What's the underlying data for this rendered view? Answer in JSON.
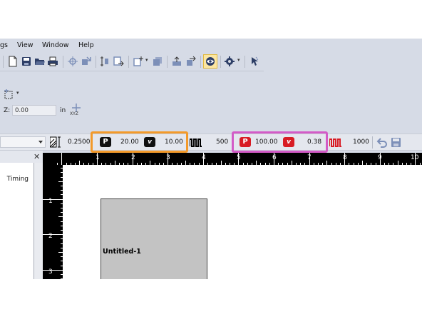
{
  "menu": [
    "gs",
    "View",
    "Window",
    "Help"
  ],
  "toolbar": {
    "icons": [
      "new-file-icon",
      "save-icon",
      "open-folder-icon",
      "print-icon",
      "crosshair-icon",
      "move-icon",
      "align-icon",
      "export-icon",
      "add-icon",
      "copy-icon",
      "upload-icon",
      "transfer-icon",
      "preview-icon",
      "settings-icon",
      "pointer-icon"
    ]
  },
  "position": {
    "z_label": "Z:",
    "z_value": "0.00",
    "z_unit": "in",
    "xyz_label": "XYZ"
  },
  "raster": {
    "dpi_value": "0.2500",
    "power_label": "P",
    "power": "20.00",
    "speed_label": "v",
    "speed": "10.00",
    "ppi": "500"
  },
  "vector": {
    "power_label": "P",
    "power": "100.00",
    "speed_label": "v",
    "speed": "0.38",
    "frequency": "1000"
  },
  "panel": {
    "close": "✕",
    "column_header": "Timing"
  },
  "ruler": {
    "h_labels": [
      "1",
      "2",
      "3",
      "4",
      "5",
      "6",
      "7",
      "8",
      "9",
      "10"
    ],
    "v_labels": [
      "1",
      "2",
      "3"
    ]
  },
  "canvas": {
    "object_label": "Untitled-1"
  },
  "colors": {
    "raster_highlight": "#f39a2a",
    "vector_highlight": "#d35bc7",
    "vector_badge": "#d81c24"
  }
}
